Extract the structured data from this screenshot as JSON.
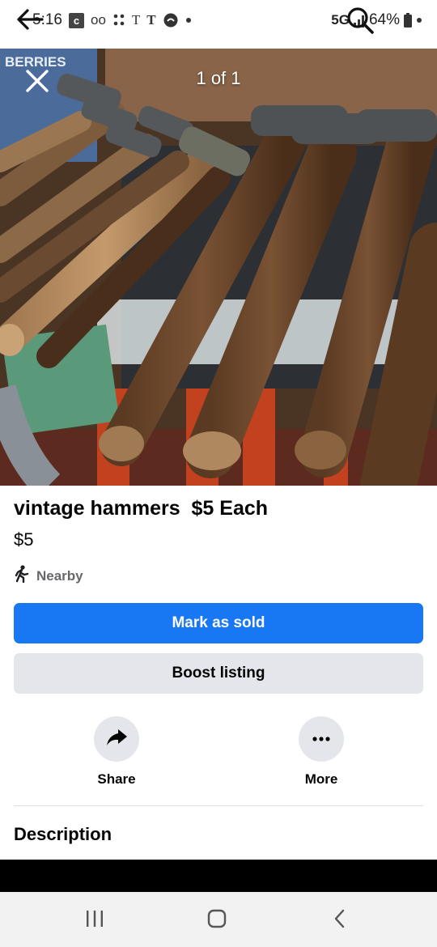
{
  "status_bar": {
    "time": "5:16",
    "notif_box": "c",
    "notif_vm": "oo",
    "notif_carrier1": "T",
    "notif_carrier2": "T",
    "network": "5G",
    "battery": "64%"
  },
  "viewer": {
    "counter": "1 of 1",
    "box_text": "BERRIES"
  },
  "listing": {
    "title": "vintage hammers  $5 Each",
    "price": "$5",
    "location": "Nearby"
  },
  "buttons": {
    "mark_sold": "Mark as sold",
    "boost": "Boost listing"
  },
  "actions": {
    "share": "Share",
    "more": "More"
  },
  "sections": {
    "description": "Description"
  },
  "colors": {
    "primary": "#1877f2",
    "secondary_bg": "#e4e6eb",
    "muted_text": "#65676b"
  }
}
